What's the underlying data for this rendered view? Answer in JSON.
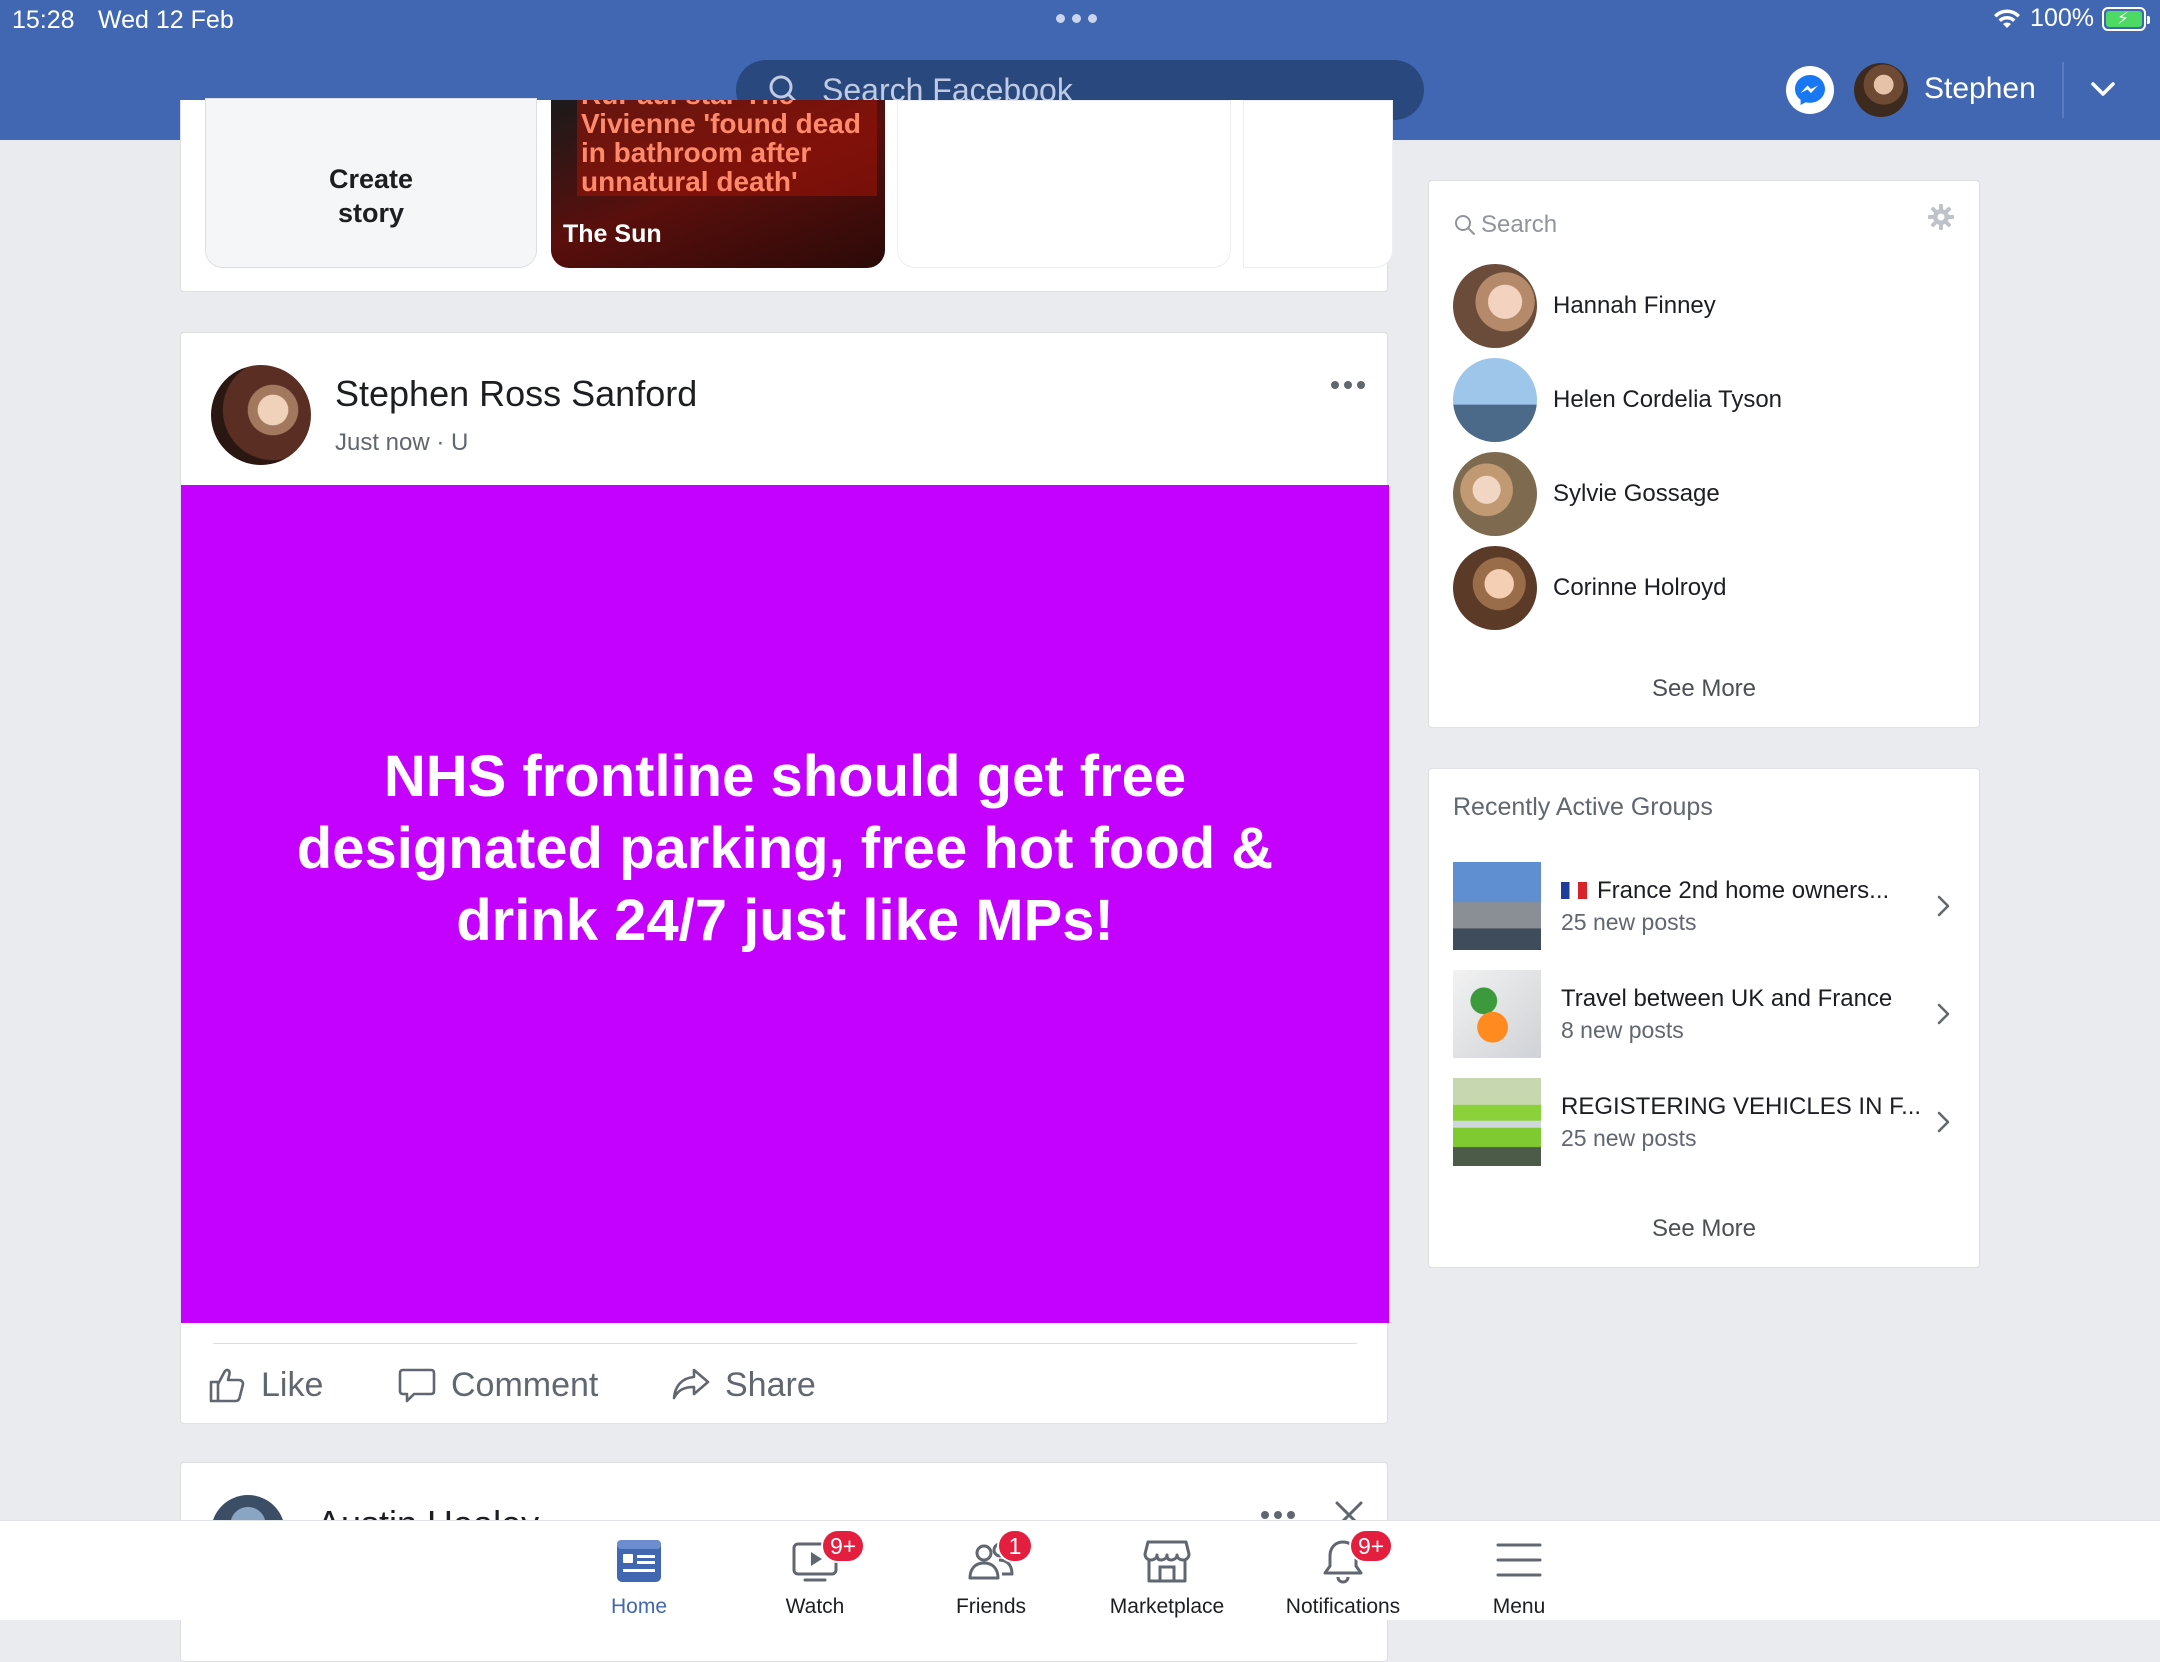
{
  "status_bar": {
    "time": "15:28",
    "date": "Wed 12 Feb",
    "battery": "100%"
  },
  "header": {
    "search_placeholder": "Search Facebook",
    "user_name": "Stephen"
  },
  "stories": {
    "create_label_line1": "Create",
    "create_label_line2": "story",
    "news_story": {
      "headline": "RuPaul star The Vivienne 'found dead in bathroom after unnatural death'",
      "source": "The Sun"
    }
  },
  "post": {
    "author": "Stephen Ross Sanford",
    "meta": "Just now · U",
    "text": "NHS frontline should get free designated parking, free hot food & drink 24/7 just like MPs!",
    "background_color": "#c400ff",
    "actions": {
      "like": "Like",
      "comment": "Comment",
      "share": "Share"
    }
  },
  "next_post": {
    "author": "Austin Healey"
  },
  "contacts": {
    "search_placeholder": "Search",
    "items": [
      {
        "name": "Hannah Finney"
      },
      {
        "name": "Helen Cordelia Tyson"
      },
      {
        "name": "Sylvie Gossage"
      },
      {
        "name": "Corinne Holroyd"
      }
    ],
    "see_more": "See More"
  },
  "groups": {
    "title": "Recently Active Groups",
    "items": [
      {
        "name": "France 2nd home owners...",
        "posts": "25 new posts",
        "has_flag": true
      },
      {
        "name": "Travel between UK and France",
        "posts": "8 new posts",
        "has_flag": false
      },
      {
        "name": "REGISTERING VEHICLES IN F...",
        "posts": "25 new posts",
        "has_flag": false
      }
    ],
    "see_more": "See More"
  },
  "bottom_nav": {
    "items": [
      {
        "label": "Home",
        "icon": "home-icon",
        "badge": ""
      },
      {
        "label": "Watch",
        "icon": "watch-icon",
        "badge": "9+"
      },
      {
        "label": "Friends",
        "icon": "friends-icon",
        "badge": "1"
      },
      {
        "label": "Marketplace",
        "icon": "marketplace-icon",
        "badge": ""
      },
      {
        "label": "Notifications",
        "icon": "bell-icon",
        "badge": "9+"
      },
      {
        "label": "Menu",
        "icon": "menu-icon",
        "badge": ""
      }
    ],
    "active_color": "#4267b2",
    "badge_color": "#e41e3f"
  },
  "colors": {
    "brand": "#4267b2",
    "brand_dark": "#29487d",
    "page_bg": "#e9ebee"
  }
}
